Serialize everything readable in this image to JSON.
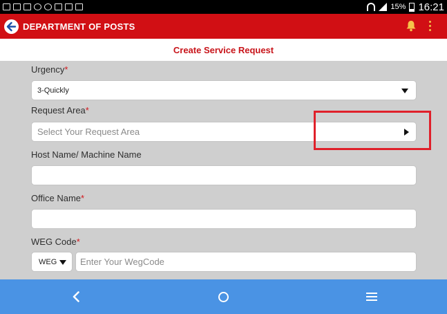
{
  "status_bar": {
    "battery_percent": "15%",
    "time": "16:21",
    "left_icons": [
      "news-icon",
      "mail-icon",
      "usb-icon",
      "whatsapp-icon",
      "signal-app-icon",
      "screenshot-icon",
      "gallery-icon",
      "mail-alt-icon"
    ],
    "right_icons": [
      "wifi-icon",
      "signal-icon",
      "battery-icon"
    ]
  },
  "app_bar": {
    "title": "DEPARTMENT OF POSTS",
    "icons": [
      "back-icon",
      "bell-icon",
      "overflow-menu-icon"
    ],
    "accent_color": "#d10f14"
  },
  "page": {
    "title": "Create Service Request"
  },
  "form": {
    "urgency": {
      "label": "Urgency",
      "required_mark": "*",
      "value": "3-Quickly"
    },
    "request_area": {
      "label": "Request Area",
      "required_mark": "*",
      "placeholder": "Select Your Request Area"
    },
    "host_name": {
      "label": "Host Name/ Machine Name",
      "value": ""
    },
    "office_name": {
      "label": "Office Name",
      "required_mark": "*",
      "value": ""
    },
    "weg_code": {
      "label": "WEG Code",
      "required_mark": "*",
      "select_value": "WEG",
      "placeholder": "Enter Your WegCode"
    }
  },
  "nav_bar": {
    "icons": [
      "nav-back-icon",
      "nav-home-icon",
      "nav-menu-icon"
    ],
    "color": "#4a93e4"
  }
}
